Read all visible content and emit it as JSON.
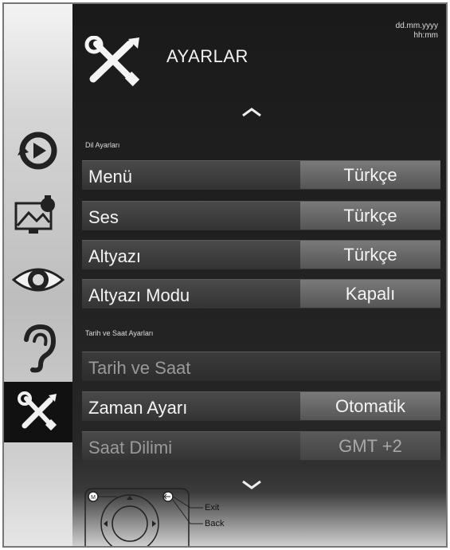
{
  "header": {
    "title": "AYARLAR",
    "date_placeholder": "dd.mm.yyyy",
    "time_placeholder": "hh:mm"
  },
  "sidebar": {
    "items": [
      {
        "icon": "source-icon",
        "active": false
      },
      {
        "icon": "picture-settings-icon",
        "active": false
      },
      {
        "icon": "eye-icon",
        "active": false
      },
      {
        "icon": "ear-icon",
        "active": false
      },
      {
        "icon": "tools-icon",
        "active": true
      }
    ]
  },
  "sections": {
    "language": "Dil Ayarları",
    "datetime": "Tarih ve Saat Ayarları"
  },
  "rows": {
    "menu": {
      "label": "Menü",
      "value": "Türkçe"
    },
    "audio": {
      "label": "Ses",
      "value": "Türkçe"
    },
    "subtitle": {
      "label": "Altyazı",
      "value": "Türkçe"
    },
    "subtitle_mode": {
      "label": "Altyazı Modu",
      "value": "Kapalı"
    },
    "date_time": {
      "label": "Tarih ve Saat"
    },
    "time_setting": {
      "label": "Zaman Ayarı",
      "value": "Otomatik"
    },
    "time_zone": {
      "label": "Saat Dilimi",
      "value": "GMT +2"
    }
  },
  "footer": {
    "exit_label": "Exit",
    "back_label": "Back"
  }
}
